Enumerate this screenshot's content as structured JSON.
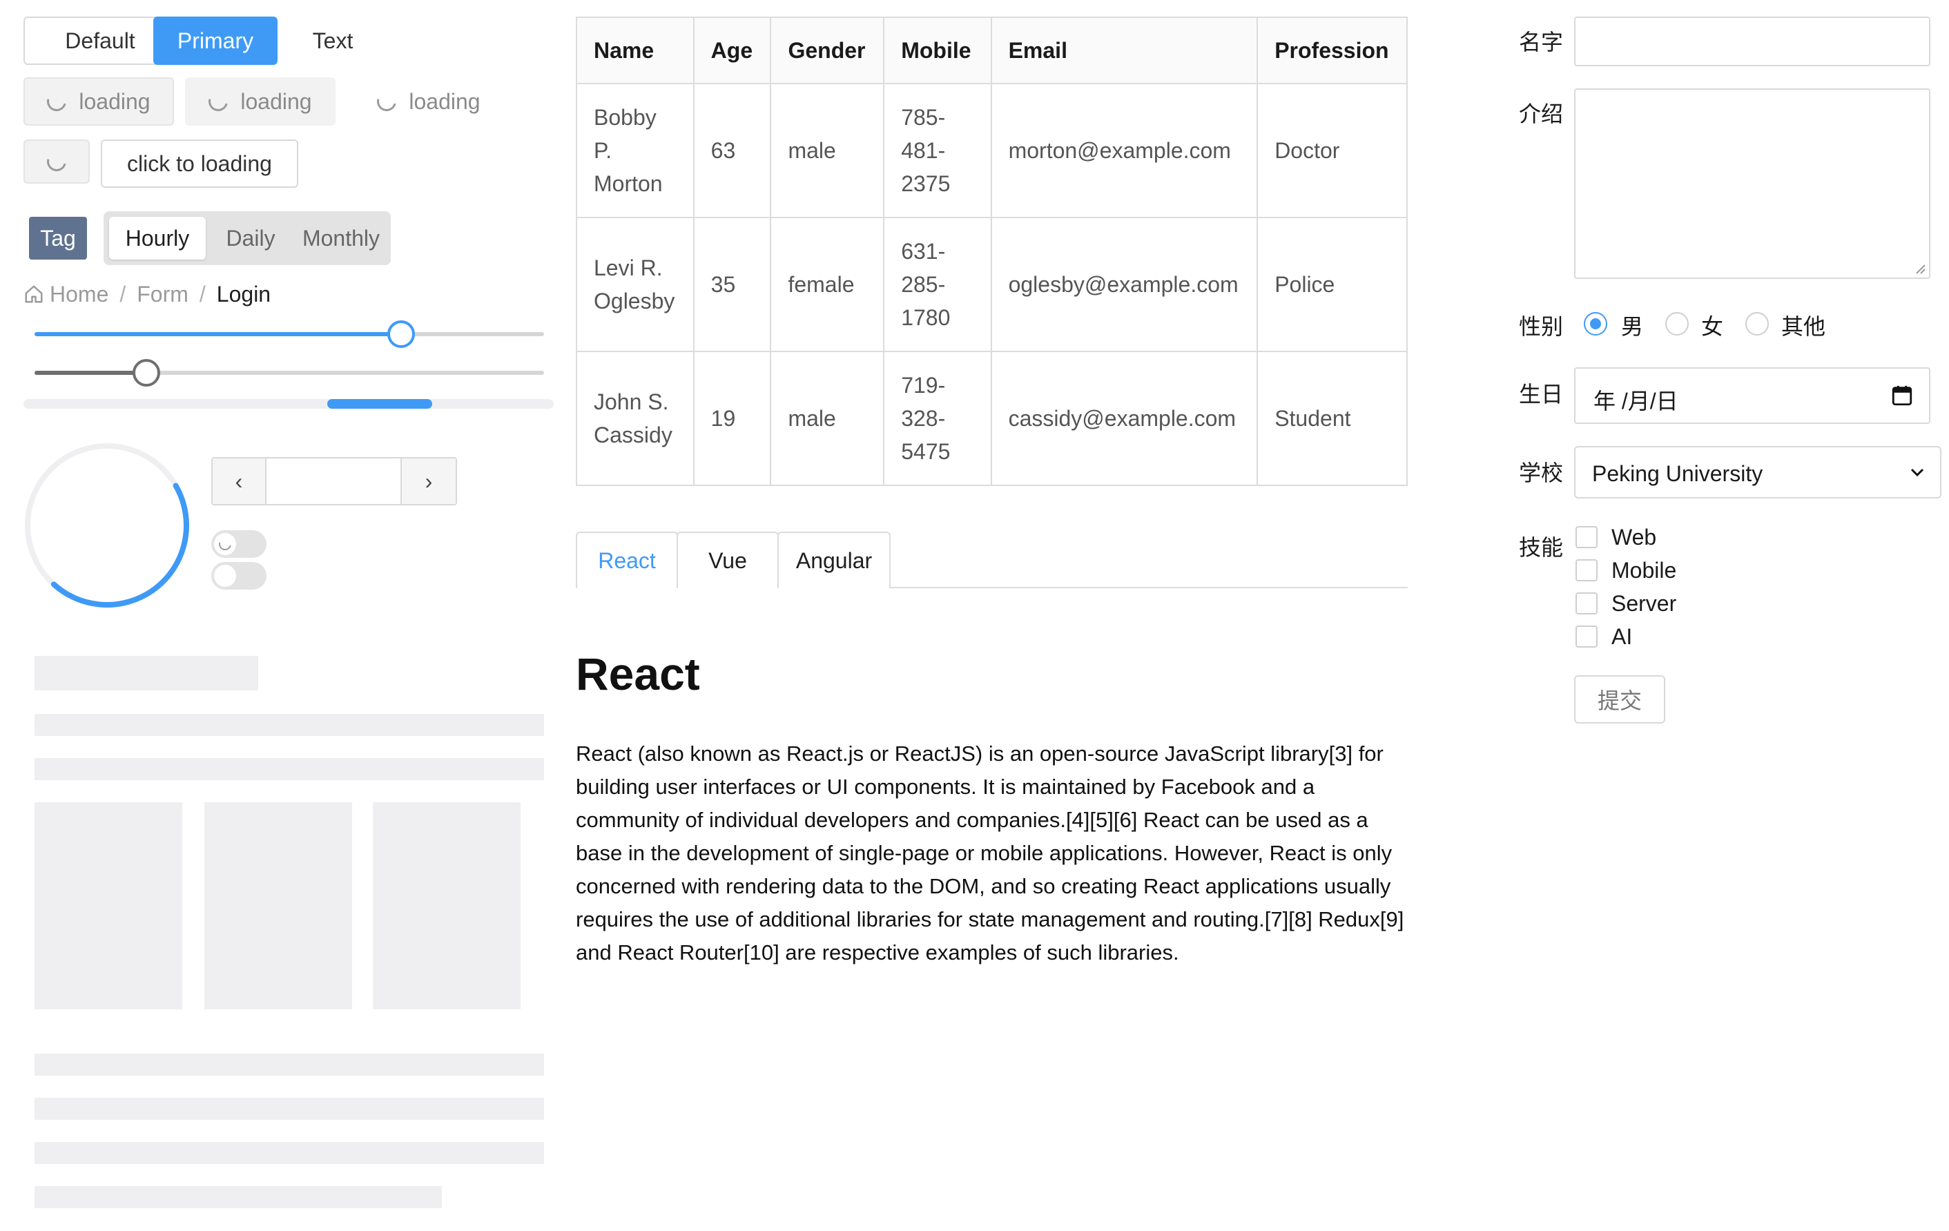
{
  "buttons": {
    "default": "Default",
    "primary": "Primary",
    "text": "Text",
    "loading": "loading",
    "click_to_loading": "click to loading"
  },
  "tag": {
    "label": "Tag"
  },
  "segmented": {
    "items": [
      "Hourly",
      "Daily",
      "Monthly"
    ],
    "selected": "Hourly"
  },
  "breadcrumb": {
    "home": "Home",
    "form": "Form",
    "login": "Login",
    "separator": "/"
  },
  "sliders": {
    "slider1_value": 0.72,
    "slider2_value": 0.22
  },
  "progress": {
    "circle_percent": 45
  },
  "pagination": {
    "prev": "‹",
    "next": "›",
    "value": ""
  },
  "table": {
    "headers": [
      "Name",
      "Age",
      "Gender",
      "Mobile",
      "Email",
      "Profession"
    ],
    "rows": [
      [
        "Bobby P. Morton",
        "63",
        "male",
        "785-481-2375",
        "morton@example.com",
        "Doctor"
      ],
      [
        "Levi R. Oglesby",
        "35",
        "female",
        "631-285-1780",
        "oglesby@example.com",
        "Police"
      ],
      [
        "John S. Cassidy",
        "19",
        "male",
        "719-328-5475",
        "cassidy@example.com",
        "Student"
      ]
    ]
  },
  "tabs": {
    "items": [
      "React",
      "Vue",
      "Angular"
    ],
    "active": "React"
  },
  "article": {
    "title": "React",
    "body": "React (also known as React.js or ReactJS) is an open-source JavaScript library[3] for building user interfaces or UI components. It is maintained by Facebook and a community of individual developers and companies.[4][5][6] React can be used as a base in the development of single-page or mobile applications. However, React is only concerned with rendering data to the DOM, and so creating React applications usually requires the use of additional libraries for state management and routing.[7][8] Redux[9] and React Router[10] are respective examples of such libraries."
  },
  "form": {
    "name_label": "名字",
    "intro_label": "介绍",
    "gender_label": "性别",
    "gender_options": [
      "男",
      "女",
      "其他"
    ],
    "gender_selected": "男",
    "birthday_label": "生日",
    "birthday_placeholder": "年 /月/日",
    "school_label": "学校",
    "school_value": "Peking University",
    "skills_label": "技能",
    "skills": [
      "Web",
      "Mobile",
      "Server",
      "AI"
    ],
    "submit": "提交"
  },
  "colors": {
    "primary": "#3f9af6",
    "tag": "#5f7290"
  },
  "icons": {
    "home": "home-icon",
    "calendar": "calendar-icon",
    "chevron": "chevron-down-icon"
  }
}
